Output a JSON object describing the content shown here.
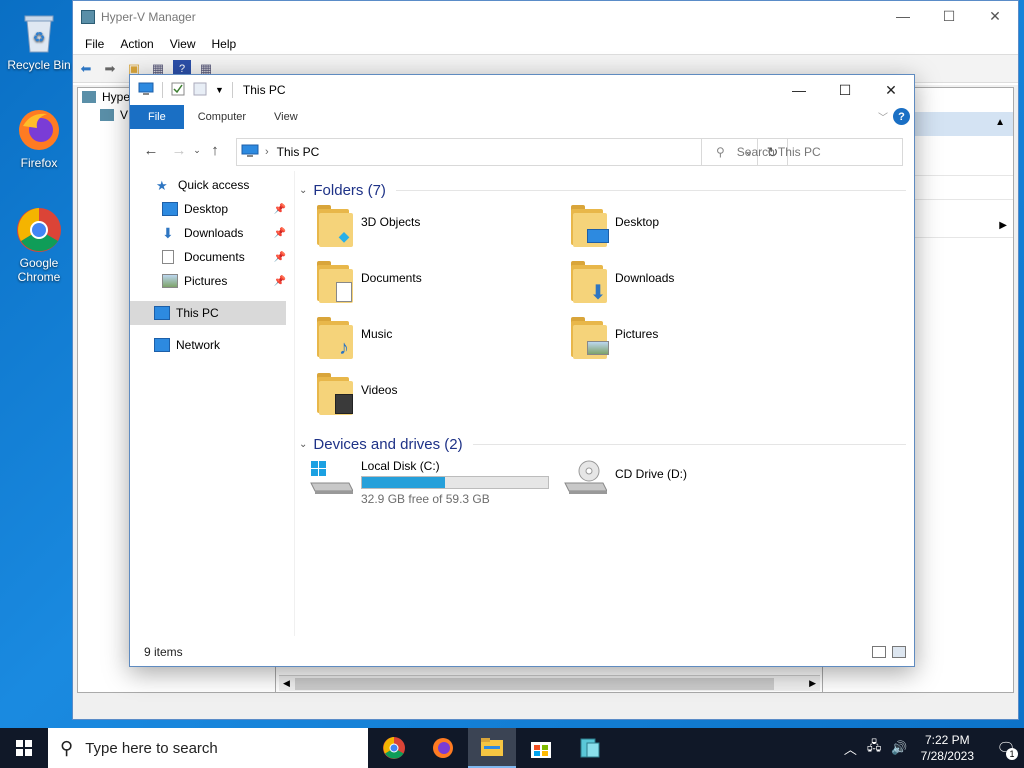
{
  "desktop": {
    "icons": [
      {
        "label": "Recycle Bin",
        "icon": "recycle-bin-icon"
      },
      {
        "label": "Firefox",
        "icon": "firefox-icon"
      },
      {
        "label": "Google Chrome",
        "icon": "chrome-icon"
      }
    ]
  },
  "hyperv": {
    "title": "Hyper-V Manager",
    "menu": [
      "File",
      "Action",
      "View",
      "Help"
    ],
    "tree": [
      "Hyper",
      "V"
    ],
    "actions_partial": [
      "k...",
      "rver"
    ]
  },
  "explorer": {
    "title": "This PC",
    "ribbon_tabs": [
      "File",
      "Computer",
      "View"
    ],
    "help": "?",
    "address": "This PC",
    "search_placeholder": "Search This PC",
    "nav": {
      "quick_access": "Quick access",
      "pinned": [
        {
          "label": "Desktop",
          "icon": "desktop-icon"
        },
        {
          "label": "Downloads",
          "icon": "downloads-icon"
        },
        {
          "label": "Documents",
          "icon": "documents-icon"
        },
        {
          "label": "Pictures",
          "icon": "pictures-icon"
        }
      ],
      "this_pc": "This PC",
      "network": "Network"
    },
    "folders_header": "Folders (7)",
    "folders": [
      {
        "label": "3D Objects",
        "icon": "3d-objects-icon"
      },
      {
        "label": "Desktop",
        "icon": "desktop-folder-icon"
      },
      {
        "label": "Documents",
        "icon": "documents-folder-icon"
      },
      {
        "label": "Downloads",
        "icon": "downloads-folder-icon"
      },
      {
        "label": "Music",
        "icon": "music-folder-icon"
      },
      {
        "label": "Pictures",
        "icon": "pictures-folder-icon"
      },
      {
        "label": "Videos",
        "icon": "videos-folder-icon"
      }
    ],
    "drives_header": "Devices and drives (2)",
    "drives": [
      {
        "label": "Local Disk (C:)",
        "free_text": "32.9 GB free of 59.3 GB",
        "used_fraction": 0.445
      },
      {
        "label": "CD Drive (D:)"
      }
    ],
    "status": "9 items"
  },
  "taskbar": {
    "search_placeholder": "Type here to search",
    "apps": [
      "chrome-icon",
      "firefox-icon",
      "file-explorer-icon",
      "store-icon",
      "hyperv-manager-icon"
    ],
    "time": "7:22 PM",
    "date": "7/28/2023",
    "notification_count": "1"
  },
  "colors": {
    "accent": "#1a6fc4",
    "desktop_bg": "#0a6fc4",
    "taskbar_bg": "#101828",
    "progress": "#26a0da"
  }
}
